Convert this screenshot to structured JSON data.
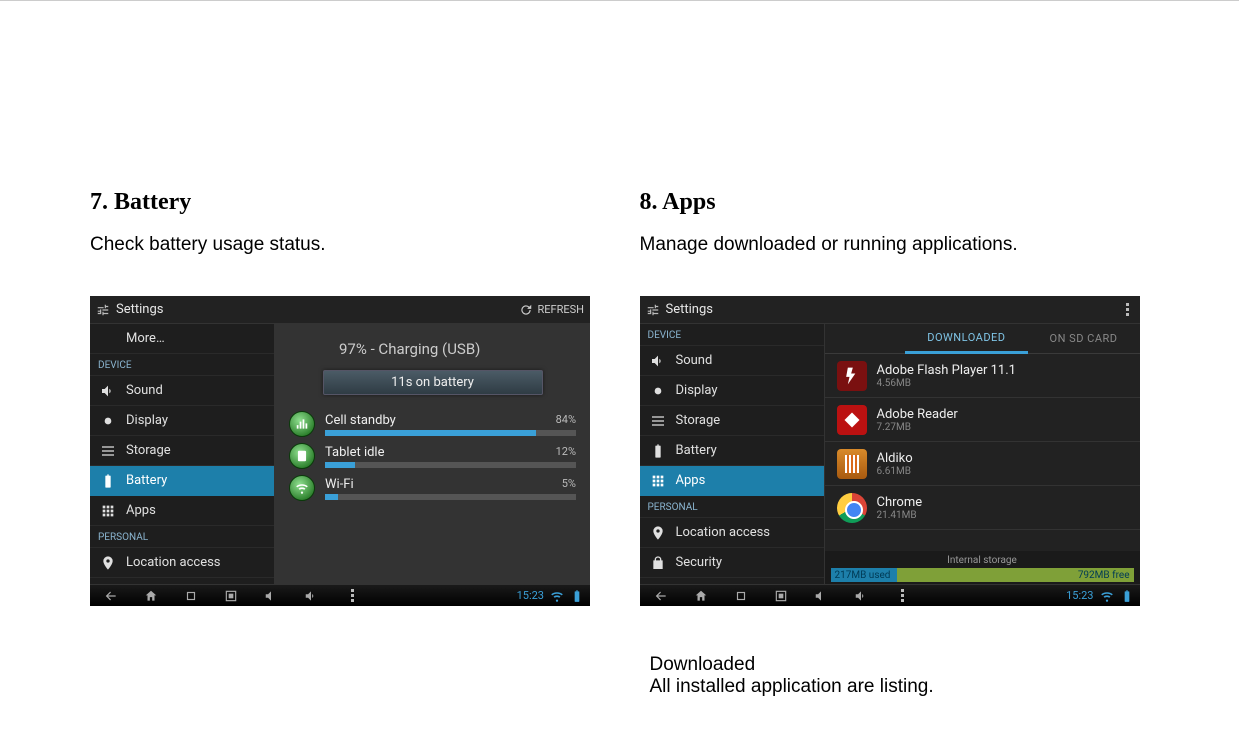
{
  "sections": {
    "battery": {
      "title": "7. Battery",
      "desc": "Check battery usage status."
    },
    "apps": {
      "title": "8. Apps",
      "desc": "Manage downloaded or running applications.",
      "footer1": "Downloaded",
      "footer2": "All installed application are listing."
    }
  },
  "screenshot_common": {
    "header_title": "Settings",
    "refresh_label": "REFRESH"
  },
  "battery_shot": {
    "sidebar": {
      "items_top": [
        {
          "label": "More…",
          "icon": ""
        }
      ],
      "section_label": "DEVICE",
      "items": [
        {
          "label": "Sound",
          "icon": "volume"
        },
        {
          "label": "Display",
          "icon": "brightness"
        },
        {
          "label": "Storage",
          "icon": "list"
        },
        {
          "label": "Battery",
          "icon": "battery",
          "selected": true
        },
        {
          "label": "Apps",
          "icon": "apps"
        }
      ],
      "section2_label": "PERSONAL",
      "items2": [
        {
          "label": "Location access",
          "icon": "location"
        }
      ]
    },
    "status": "97% - Charging (USB)",
    "on_battery": "11s on battery",
    "usage": [
      {
        "label": "Cell standby",
        "pct": "84%",
        "bar": 84
      },
      {
        "label": "Tablet idle",
        "pct": "12%",
        "bar": 12
      },
      {
        "label": "Wi-Fi",
        "pct": "5%",
        "bar": 5
      }
    ],
    "clock": "15:23"
  },
  "apps_shot": {
    "sidebar": {
      "section_label": "DEVICE",
      "items": [
        {
          "label": "Sound",
          "icon": "volume"
        },
        {
          "label": "Display",
          "icon": "brightness"
        },
        {
          "label": "Storage",
          "icon": "list"
        },
        {
          "label": "Battery",
          "icon": "battery"
        },
        {
          "label": "Apps",
          "icon": "apps",
          "selected": true
        }
      ],
      "section2_label": "PERSONAL",
      "items2": [
        {
          "label": "Location access",
          "icon": "location"
        },
        {
          "label": "Security",
          "icon": "lock"
        }
      ]
    },
    "tabs": [
      {
        "label": "DOWNLOADED",
        "active": true
      },
      {
        "label": "ON SD CARD",
        "active": false
      }
    ],
    "apps": [
      {
        "name": "Adobe Flash Player 11.1",
        "size": "4.56MB",
        "icon": "flash"
      },
      {
        "name": "Adobe Reader",
        "size": "7.27MB",
        "icon": "reader"
      },
      {
        "name": "Aldiko",
        "size": "6.61MB",
        "icon": "aldiko"
      },
      {
        "name": "Chrome",
        "size": "21.41MB",
        "icon": "chrome"
      }
    ],
    "storage": {
      "label": "Internal storage",
      "used_text": "217MB used",
      "free_text": "792MB free",
      "used_pct": 22
    },
    "clock": "15:23"
  }
}
